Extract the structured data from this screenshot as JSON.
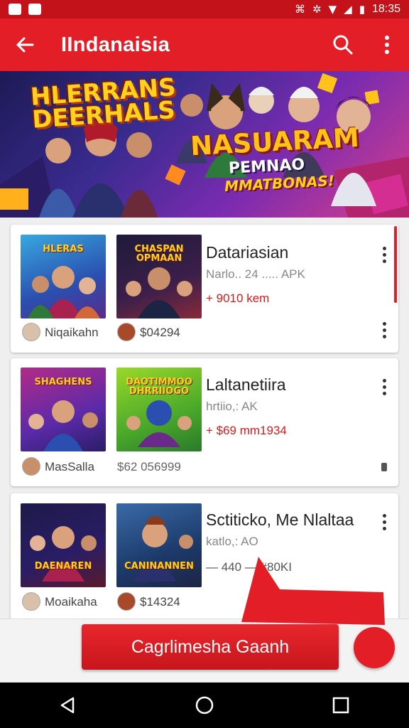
{
  "status_bar": {
    "time": "18:35",
    "icons": [
      "app-icon",
      "notification-icon",
      "signal-icon",
      "settings-icon",
      "wifi-icon",
      "cell-signal-icon",
      "battery-icon"
    ]
  },
  "app_bar": {
    "back_icon": "arrow-left-icon",
    "title": "IIndanaisia",
    "search_icon": "search-icon",
    "menu_icon": "more-vert-icon",
    "background": "#e41e26"
  },
  "banner": {
    "title": "HLERRANS DEERHALS",
    "headline": "NASUARAM",
    "sub1": "PEMNAO",
    "sub2": "MMATBONAS!",
    "pager_count": 2,
    "active_index": 1
  },
  "games": [
    {
      "thumb1_label": "HLERAS",
      "thumb2_label": "CHASPAN OPMAAN",
      "author": "Niqaikahn",
      "count": "$04294",
      "title": "Datariasian",
      "subtitle": "Narlo.. 24 ..... APK",
      "price": "+ 9010 kem"
    },
    {
      "thumb1_label": "SHAGHENS",
      "thumb2_label": "DAOTIMMOO DHRRIIOGO",
      "author": "MasSalla",
      "count": "$62 056999",
      "title": "Laltanetiira",
      "subtitle": "hrtiio,: AK",
      "price": "+ $69 mm1934"
    },
    {
      "thumb1_label": "DAENAREN",
      "thumb2_label": "CANINANNEN",
      "author": "Moaikaha",
      "count": "$14324",
      "title": "Sctiticko, Me Nlaltaa",
      "subtitle": "katlo,: AO",
      "price": "— 440 — #80KI"
    }
  ],
  "cta": {
    "label": "Cagrlimesha Gaanh",
    "color": "#e41e26"
  },
  "nav_bar": {
    "back_icon": "nav-back-icon",
    "home_icon": "nav-home-icon",
    "recents_icon": "nav-recents-icon"
  }
}
